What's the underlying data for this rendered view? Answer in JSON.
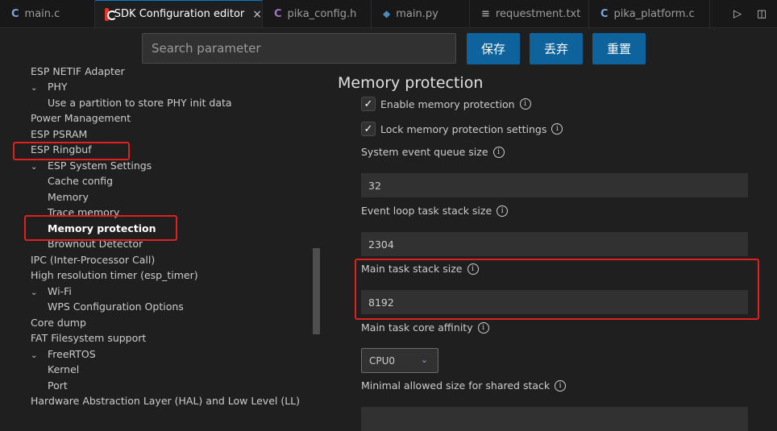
{
  "tabs": [
    {
      "label": "main.c",
      "icon": "c-file-icon",
      "active": false
    },
    {
      "label": "SDK Configuration editor",
      "icon": "espressif-icon",
      "active": true
    },
    {
      "label": "pika_config.h",
      "icon": "c-header-icon",
      "active": false
    },
    {
      "label": "main.py",
      "icon": "python-icon",
      "active": false
    },
    {
      "label": "requestment.txt",
      "icon": "text-file-icon",
      "active": false
    },
    {
      "label": "pika_platform.c",
      "icon": "c-file-icon",
      "active": false
    }
  ],
  "icons": {
    "c": "C",
    "h": "C",
    "close": "×",
    "run": "▷",
    "split": "◫",
    "chevron_down": "⌄",
    "check": "✓",
    "info": "i"
  },
  "search": {
    "placeholder": "Search parameter"
  },
  "buttons": {
    "save": "保存",
    "discard": "丢弃",
    "reset": "重置"
  },
  "tree": [
    {
      "label": "ESP NETIF Adapter",
      "level": 0,
      "expanded": false
    },
    {
      "label": "PHY",
      "level": 1,
      "expanded": true
    },
    {
      "label": "Use a partition to store PHY init data",
      "level": 2
    },
    {
      "label": "Power Management",
      "level": 0
    },
    {
      "label": "ESP PSRAM",
      "level": 0
    },
    {
      "label": "ESP Ringbuf",
      "level": 0
    },
    {
      "label": "ESP System Settings",
      "level": 1,
      "expanded": true
    },
    {
      "label": "Cache config",
      "level": 2
    },
    {
      "label": "Memory",
      "level": 2
    },
    {
      "label": "Trace memory",
      "level": 2
    },
    {
      "label": "Memory protection",
      "level": 2,
      "selected": true
    },
    {
      "label": "Brownout Detector",
      "level": 2
    },
    {
      "label": "IPC (Inter-Processor Call)",
      "level": 0
    },
    {
      "label": "High resolution timer (esp_timer)",
      "level": 0
    },
    {
      "label": "Wi-Fi",
      "level": 1,
      "expanded": true
    },
    {
      "label": "WPS Configuration Options",
      "level": 2
    },
    {
      "label": "Core dump",
      "level": 0
    },
    {
      "label": "FAT Filesystem support",
      "level": 0
    },
    {
      "label": "FreeRTOS",
      "level": 1,
      "expanded": true
    },
    {
      "label": "Kernel",
      "level": 2
    },
    {
      "label": "Port",
      "level": 2
    },
    {
      "label": "Hardware Abstraction Layer (HAL) and Low Level (LL)",
      "level": 0
    }
  ],
  "section": {
    "title": "Memory protection"
  },
  "settings": {
    "enable_mp": {
      "label": "Enable memory protection",
      "checked": true
    },
    "lock_mp": {
      "label": "Lock memory protection settings",
      "checked": true
    },
    "event_queue": {
      "label": "System event queue size",
      "value": "32"
    },
    "event_loop": {
      "label": "Event loop task stack size",
      "value": "2304"
    },
    "main_stack": {
      "label": "Main task stack size",
      "value": "8192"
    },
    "affinity": {
      "label": "Main task core affinity",
      "value": "CPU0"
    },
    "min_shared": {
      "label": "Minimal allowed size for shared stack"
    }
  },
  "colors": {
    "accent": "#0e639c",
    "highlight": "#e02020",
    "background": "#1f1f1f"
  }
}
